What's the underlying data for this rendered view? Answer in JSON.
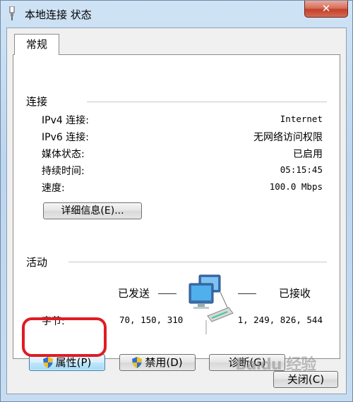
{
  "window": {
    "title": "本地连接 状态",
    "close_label": "✕"
  },
  "tab": {
    "label": "常规"
  },
  "connection": {
    "section_title": "连接",
    "rows": [
      {
        "label": "IPv4 连接:",
        "value": "Internet"
      },
      {
        "label": "IPv6 连接:",
        "value": "无网络访问权限"
      },
      {
        "label": "媒体状态:",
        "value": "已启用"
      },
      {
        "label": "持续时间:",
        "value": "05:15:45"
      },
      {
        "label": "速度:",
        "value": "100.0 Mbps"
      }
    ],
    "details_button": "详细信息(E)..."
  },
  "activity": {
    "section_title": "活动",
    "sent_label": "已发送",
    "received_label": "已接收",
    "bytes_label": "字节:",
    "bytes_sent": "70, 150, 310",
    "bytes_received": "1, 249, 826, 544"
  },
  "buttons": {
    "properties": "属性(P)",
    "disable": "禁用(D)",
    "diagnose": "诊断(G)",
    "close": "关闭(C)"
  },
  "watermark": "Baidu 经验",
  "colors": {
    "highlight": "#e01b24",
    "title_bar": "#c6dcf1",
    "close_button": "#c4402a"
  },
  "icons": {
    "title": "network-plug-icon",
    "activity": "network-computers-icon",
    "shield": "uac-shield-icon"
  }
}
